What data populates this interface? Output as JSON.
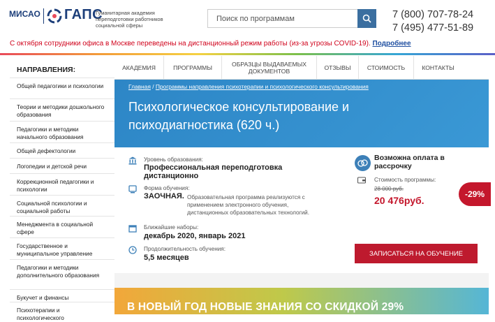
{
  "header": {
    "logo_misao": "МИСАО",
    "logo_gaps": "ГАПС",
    "logo_subtitle": "Гуманитарная академия переподготовки работников социальной сферы",
    "search_placeholder": "Поиск по программам",
    "phone1": "7 (800) 707-78-24",
    "phone2": "7 (495) 477-51-89"
  },
  "notice": {
    "text": "С октября сотрудники офиса в Москве переведены на дистанционный режим работы (из-за угрозы COVID-19).",
    "link": "Подробнее"
  },
  "sidebar": {
    "title": "НАПРАВЛЕНИЯ:",
    "items": [
      {
        "label": "Общей педагогики и психологии"
      },
      {
        "label": "Теории и методики дошкольного образования"
      },
      {
        "label": "Педагогики и методики начального образования"
      },
      {
        "label": "Общей дефектологии"
      },
      {
        "label": "Логопедии и детской речи"
      },
      {
        "label": "Коррекционной педагогики и психологии"
      },
      {
        "label": "Социальной психологии и социальной работы"
      },
      {
        "label": "Менеджмента в социальной сфере"
      },
      {
        "label": "Государственное и муниципальное управление"
      },
      {
        "label": "Педагогики и методики дополнительного образования"
      },
      {
        "label": "Букучет и финансы"
      },
      {
        "label": "Психотерапии и психологического"
      }
    ]
  },
  "nav": {
    "items": [
      {
        "label": "АКАДЕМИЯ"
      },
      {
        "label": "ПРОГРАММЫ"
      },
      {
        "label": "ОБРАЗЦЫ ВЫДАВАЕМЫХ ДОКУМЕНТОВ"
      },
      {
        "label": "ОТЗЫВЫ"
      },
      {
        "label": "СТОИМОСТЬ"
      },
      {
        "label": "КОНТАКТЫ"
      }
    ]
  },
  "hero": {
    "crumb_home": "Главная",
    "crumb_sep": "/",
    "crumb_current": "Программы направления психотерапии и психологического консультирования",
    "title": "Психологическое консультирование и психодиагностика (620 ч.)"
  },
  "info": {
    "level_label": "Уровень образования:",
    "level_value": "Профессиональная переподготовка дистанционно",
    "form_label": "Форма обучения:",
    "form_value": "ЗАОЧНАЯ.",
    "form_desc": "Образовательная программа реализуются с применением электронного обучения, дистанционных образовательных технологий.",
    "intake_label": "Ближайшие наборы:",
    "intake_value": "декабрь 2020, январь 2021",
    "duration_label": "Продолжительность обучения:",
    "duration_value": "5,5 месяцев"
  },
  "pricing": {
    "installment": "Возможна оплата в рассрочку",
    "cost_label": "Стоимость программы:",
    "old_price": "28 000 руб.",
    "new_price": "20 476руб.",
    "discount": "-29%",
    "enroll_button": "ЗАПИСАТЬСЯ НА ОБУЧЕНИЕ"
  },
  "promo": {
    "text": "В НОВЫЙ ГОД НОВЫЕ ЗНАНИЯ СО СКИДКОЙ 29%"
  },
  "colors": {
    "brand_blue": "#1d3f7a",
    "hero_blue": "#2d86c6",
    "accent_red": "#c4172c"
  }
}
